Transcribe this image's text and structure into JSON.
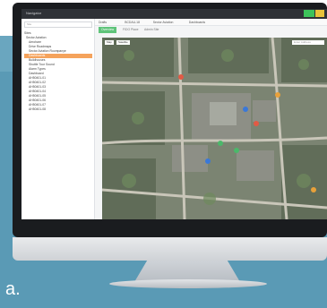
{
  "caption": {
    "text": "a."
  },
  "app": {
    "nav_title": "Navigator",
    "nav_buttons": [
      "",
      ""
    ],
    "search_placeholder": "Site",
    "tree": [
      {
        "label": "Sites",
        "selected": false
      },
      {
        "label": "Sector Aviation",
        "selected": false
      },
      {
        "label": "Aerohare",
        "selected": false
      },
      {
        "label": "Drive Roadmaps",
        "selected": false
      },
      {
        "label": "Sector Aviation Roompanye",
        "selected": false
      },
      {
        "label": "Dashboards",
        "selected": true
      },
      {
        "label": "Buildhouses",
        "selected": false
      },
      {
        "label": "Shuttle Tour Sound",
        "selected": false
      },
      {
        "label": "Alarm Types",
        "selected": false
      },
      {
        "label": "Dashboard",
        "selected": false
      },
      {
        "label": "AH50401-01",
        "selected": false
      },
      {
        "label": "AH50401-02",
        "selected": false
      },
      {
        "label": "AH50401-03",
        "selected": false
      },
      {
        "label": "AH50401-04",
        "selected": false
      },
      {
        "label": "AH50401-05",
        "selected": false
      },
      {
        "label": "AH50401-06",
        "selected": false
      },
      {
        "label": "AH50401-07",
        "selected": false
      },
      {
        "label": "AH50401-08",
        "selected": false
      }
    ],
    "toolbar": {
      "crumbs": [
        "Drafts",
        "BCDAU-18",
        "Sector Aviation",
        "Dashboards"
      ],
      "tabs": [
        "Overview",
        "FIDO Place",
        "Admin Site"
      ],
      "active_tab": 0
    },
    "map": {
      "controls": [
        "Map",
        "Satellite"
      ],
      "search_placeholder": "Enter Address"
    }
  },
  "colors": {
    "accent_green": "#5fc47a",
    "nav_green": "#3cc35a",
    "nav_yellow": "#e8c33a",
    "selected_orange": "#f5a35c",
    "backdrop": "#5a9ab5"
  }
}
